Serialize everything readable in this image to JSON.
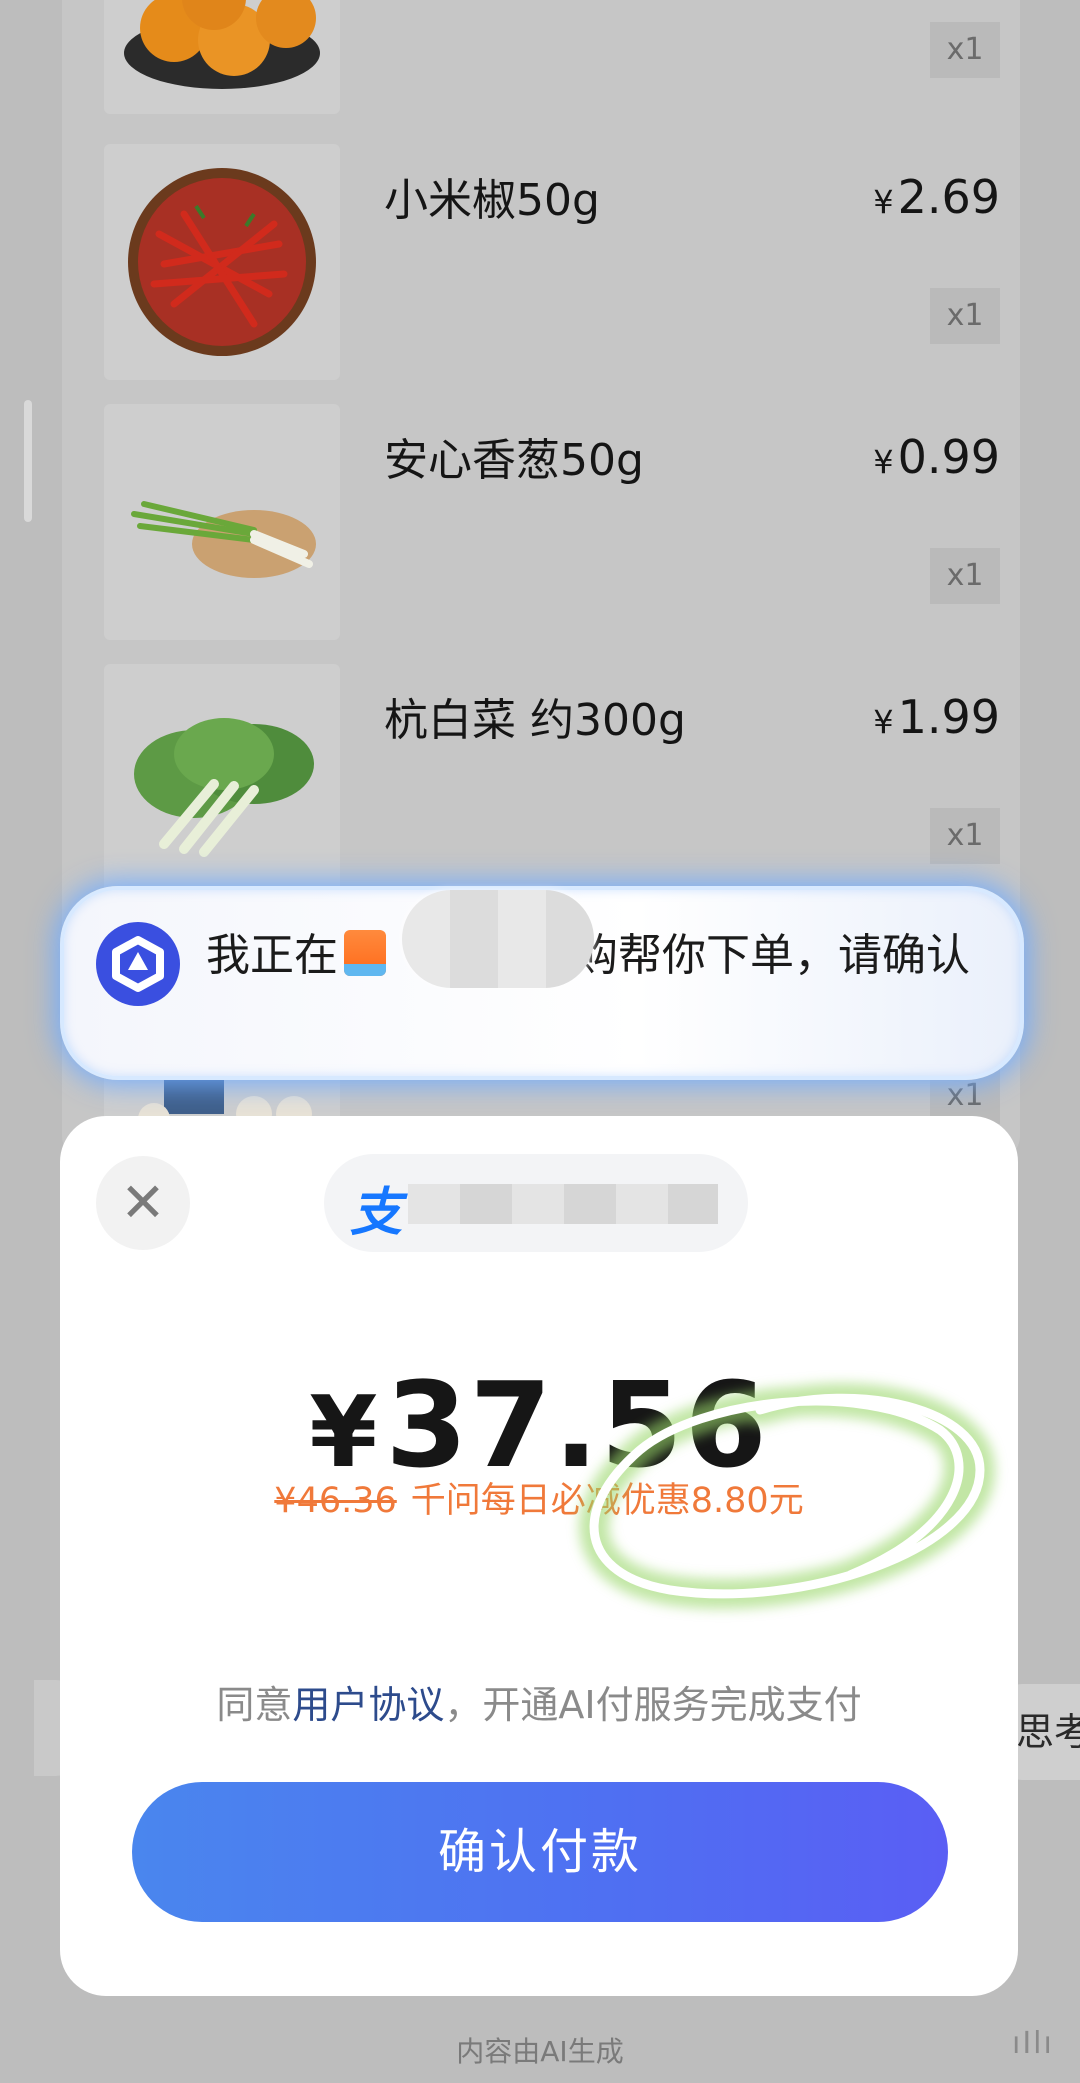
{
  "products": [
    {
      "name": "",
      "price": "",
      "qty": "x1"
    },
    {
      "name": "小米椒50g",
      "price": "2.69",
      "qty": "x1"
    },
    {
      "name": "安心香葱50g",
      "price": "0.99",
      "qty": "x1"
    },
    {
      "name": "杭白菜 约300g",
      "price": "1.99",
      "qty": "x1"
    },
    {
      "name": "",
      "price": "",
      "qty": "x1"
    }
  ],
  "currency_symbol": "¥",
  "notice": {
    "text_before": "我正在",
    "text_after": "购帮你下单，请确认"
  },
  "payment": {
    "close_icon": "✕",
    "alipay_mark": "支",
    "amount": "37.56",
    "original_price": "¥46.36",
    "discount_text": "千问每日必减优惠8.80元",
    "agreement_prefix": "同意",
    "agreement_link": "用户协议",
    "agreement_suffix": "，开通AI付服务完成支付",
    "confirm_label": "确认付款"
  },
  "side_chip_right": "思考",
  "footer_note": "内容由AI生成",
  "colors": {
    "pay_button": "#4f6ff2",
    "discount": "#f0793a",
    "link": "#2d4b8c",
    "notice_glow": "#6eaaff",
    "logo": "#3a4fe0",
    "scribble": "#8fd06a"
  }
}
